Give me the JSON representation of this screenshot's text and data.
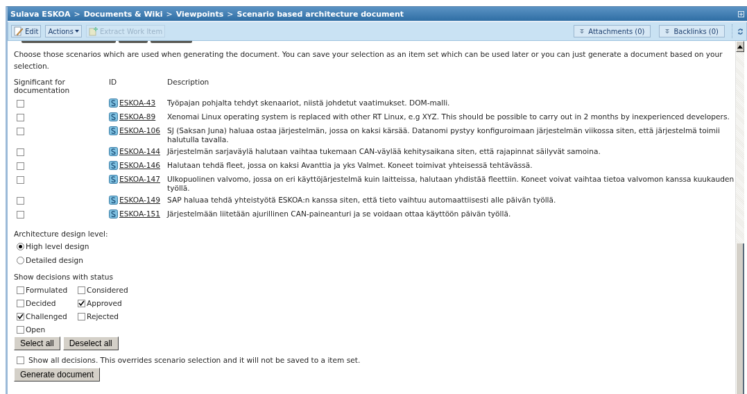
{
  "breadcrumb": [
    "Sulava ESKOA",
    "Documents & Wiki",
    "Viewpoints",
    "Scenario based architecture document"
  ],
  "breadcrumb_separator": ">",
  "toolbar": {
    "left": [
      {
        "label": "Edit",
        "kind": "edit",
        "disabled": false
      },
      {
        "label": "Actions",
        "kind": "menu",
        "disabled": false
      },
      {
        "label": "Extract Work Item",
        "kind": "extract",
        "disabled": true
      }
    ],
    "right": [
      {
        "label": "Attachments (0)"
      },
      {
        "label": "Backlinks (0)"
      }
    ]
  },
  "intro": "Choose those scenarios which are used when generating the document. You can save your selection as an item set which can be used later or you can just generate a document based on your selection.",
  "table": {
    "columns": [
      "Significant for documentation",
      "ID",
      "Description"
    ],
    "rows": [
      {
        "checked": false,
        "id": "ESKOA-43",
        "description": "Työpajan pohjalta tehdyt skenaariot, niistä johdetut vaatimukset. DOM-malli."
      },
      {
        "checked": false,
        "id": "ESKOA-89",
        "description": "Xenomai Linux operating system is replaced with other RT Linux, e.g XYZ. This should be possible to carry out in 2 months by inexperienced developers."
      },
      {
        "checked": false,
        "id": "ESKOA-106",
        "description": "SJ (Saksan Juna) haluaa ostaa järjestelmän, jossa on kaksi kärsää. Datanomi pystyy konfiguroimaan järjestelmän viikossa siten, että järjestelmä toimii halutulla tavalla."
      },
      {
        "checked": false,
        "id": "ESKOA-144",
        "description": "Järjestelmän sarjaväylä halutaan vaihtaa tukemaan CAN-väylää kehitysaikana siten, että rajapinnat säilyvät samoina."
      },
      {
        "checked": false,
        "id": "ESKOA-146",
        "description": "Halutaan tehdä fleet, jossa on kaksi Avanttia ja yks Valmet. Koneet toimivat yhteisessä tehtävässä."
      },
      {
        "checked": false,
        "id": "ESKOA-147",
        "description": "Ulkopuolinen valvomo, jossa on eri käyttöjärjestelmä kuin laitteissa, halutaan yhdistää fleettiin. Koneet voivat vaihtaa tietoa valvomon kanssa kuukauden työllä."
      },
      {
        "checked": false,
        "id": "ESKOA-149",
        "description": "SAP haluaa tehdä yhteistyötä ESKOA:n kanssa siten, että tieto vaihtuu automaattiisesti alle päivän työllä."
      },
      {
        "checked": false,
        "id": "ESKOA-151",
        "description": "Järjestelmään liitetään ajurillinen CAN-paineanturi ja se voidaan ottaa käyttöön päivän työllä."
      }
    ]
  },
  "design_level": {
    "label": "Architecture design level:",
    "options": [
      {
        "label": "High level design",
        "selected": true
      },
      {
        "label": "Detailed design",
        "selected": false
      }
    ]
  },
  "statuses": {
    "label": "Show decisions with status",
    "items": [
      {
        "label": "Formulated",
        "checked": false
      },
      {
        "label": "Considered",
        "checked": false
      },
      {
        "label": "Decided",
        "checked": false
      },
      {
        "label": "Approved",
        "checked": true
      },
      {
        "label": "Challenged",
        "checked": true
      },
      {
        "label": "Rejected",
        "checked": false
      },
      {
        "label": "Open",
        "checked": false
      }
    ],
    "buttons": [
      "Select all",
      "Deselect all"
    ]
  },
  "show_all": {
    "label": "Show all decisions. This overrides scenario selection and it will not be saved to a item set.",
    "checked": false
  },
  "generate_button": "Generate document"
}
